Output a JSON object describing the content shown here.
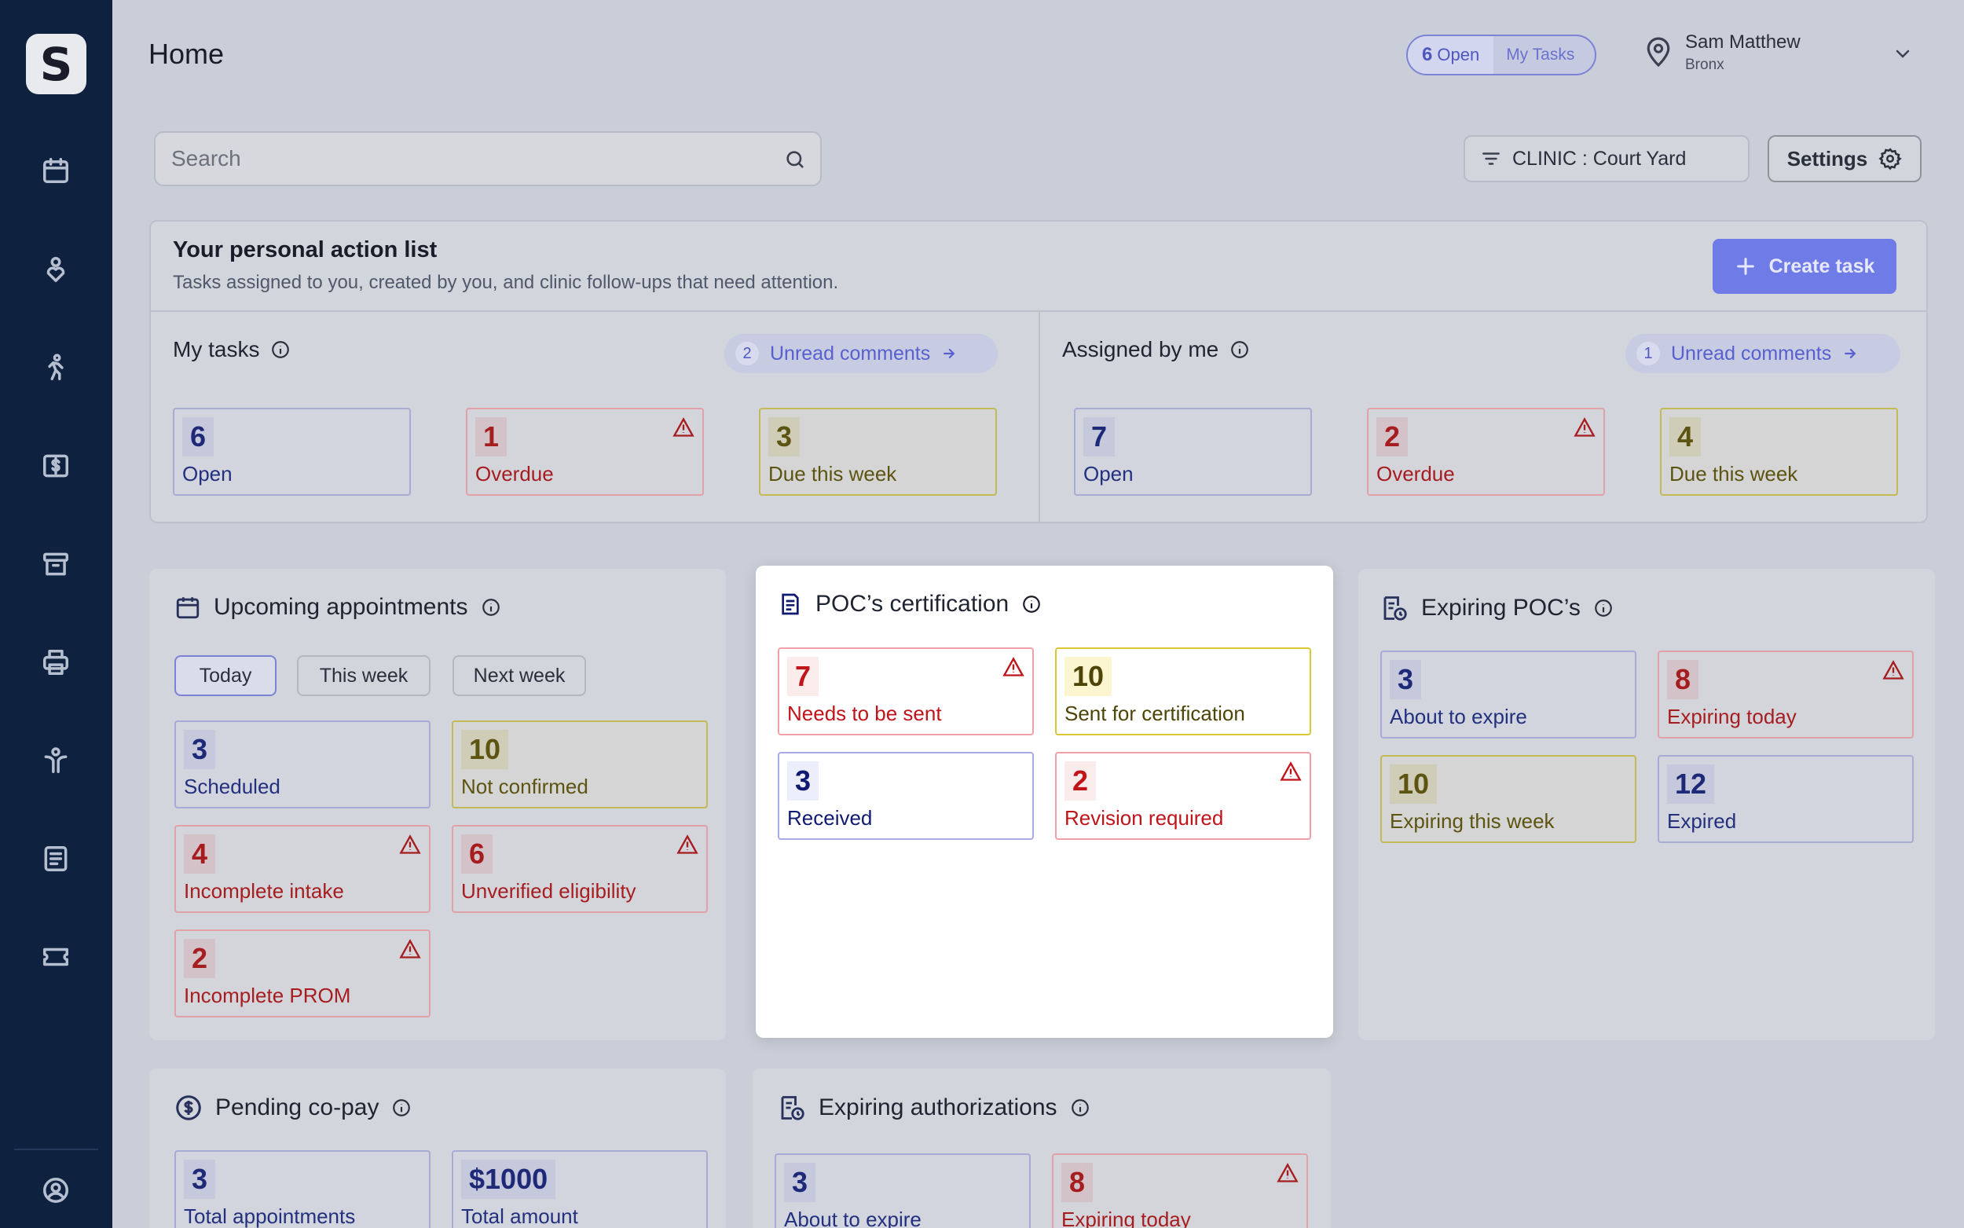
{
  "app": {
    "logo_letter": "S"
  },
  "sidebar": {
    "items": [
      "calendar-icon",
      "patient-icon",
      "exercise-icon",
      "billing-icon",
      "archive-icon",
      "print-icon",
      "staff-icon",
      "document-icon",
      "ticket-icon",
      "profile-icon"
    ]
  },
  "header": {
    "title": "Home",
    "open_count": "6",
    "open_label": "Open",
    "my_tasks_label": "My Tasks",
    "user_name": "Sam Matthew",
    "user_location": "Bronx"
  },
  "toolbar": {
    "search_placeholder": "Search",
    "clinic_filter": "CLINIC : Court Yard",
    "settings_label": "Settings"
  },
  "action_list": {
    "title": "Your personal action list",
    "subtitle": "Tasks assigned to you, created by you, and clinic follow-ups that need attention.",
    "create_label": "Create task",
    "my_tasks": {
      "title": "My tasks",
      "unread_count": "2",
      "unread_label": "Unread comments",
      "tiles": [
        {
          "value": "6",
          "label": "Open",
          "tone": "blue"
        },
        {
          "value": "1",
          "label": "Overdue",
          "tone": "red"
        },
        {
          "value": "3",
          "label": "Due this week",
          "tone": "yellow"
        }
      ]
    },
    "assigned_by_me": {
      "title": "Assigned by me",
      "unread_count": "1",
      "unread_label": "Unread comments",
      "tiles": [
        {
          "value": "7",
          "label": "Open",
          "tone": "blue"
        },
        {
          "value": "2",
          "label": "Overdue",
          "tone": "red"
        },
        {
          "value": "4",
          "label": "Due this week",
          "tone": "yellow"
        }
      ]
    }
  },
  "appointments": {
    "title": "Upcoming appointments",
    "chips": [
      "Today",
      "This week",
      "Next week"
    ],
    "active_chip": "Today",
    "tiles": [
      {
        "value": "3",
        "label": "Scheduled",
        "tone": "blue"
      },
      {
        "value": "10",
        "label": "Not confirmed",
        "tone": "yellow"
      },
      {
        "value": "4",
        "label": "Incomplete intake",
        "tone": "red"
      },
      {
        "value": "6",
        "label": "Unverified eligibility",
        "tone": "red"
      },
      {
        "value": "2",
        "label": "Incomplete PROM",
        "tone": "red"
      }
    ]
  },
  "poc_certification": {
    "title": "POC’s certification",
    "tiles": [
      {
        "value": "7",
        "label": "Needs to be sent",
        "tone": "red"
      },
      {
        "value": "10",
        "label": "Sent for certification",
        "tone": "yellow"
      },
      {
        "value": "3",
        "label": "Received",
        "tone": "blue"
      },
      {
        "value": "2",
        "label": "Revision required",
        "tone": "red"
      }
    ]
  },
  "expiring_poc": {
    "title": "Expiring POC’s",
    "tiles": [
      {
        "value": "3",
        "label": "About to expire",
        "tone": "blue"
      },
      {
        "value": "8",
        "label": "Expiring today",
        "tone": "red"
      },
      {
        "value": "10",
        "label": "Expiring this week",
        "tone": "yellow"
      },
      {
        "value": "12",
        "label": "Expired",
        "tone": "blue"
      }
    ]
  },
  "pending_copay": {
    "title": "Pending co-pay",
    "tiles": [
      {
        "value": "3",
        "label": "Total appointments",
        "tone": "blue"
      },
      {
        "value": "$1000",
        "label": "Total amount",
        "tone": "blue"
      }
    ]
  },
  "expiring_auth": {
    "title": "Expiring authorizations",
    "tiles": [
      {
        "value": "3",
        "label": "About to expire",
        "tone": "blue"
      },
      {
        "value": "8",
        "label": "Expiring today",
        "tone": "red"
      }
    ]
  },
  "colors": {
    "sidebar_bg": "#0e2240",
    "accent": "#6f7be6",
    "danger": "#c0141b",
    "warning": "#d9c834",
    "info": "#101a70"
  }
}
